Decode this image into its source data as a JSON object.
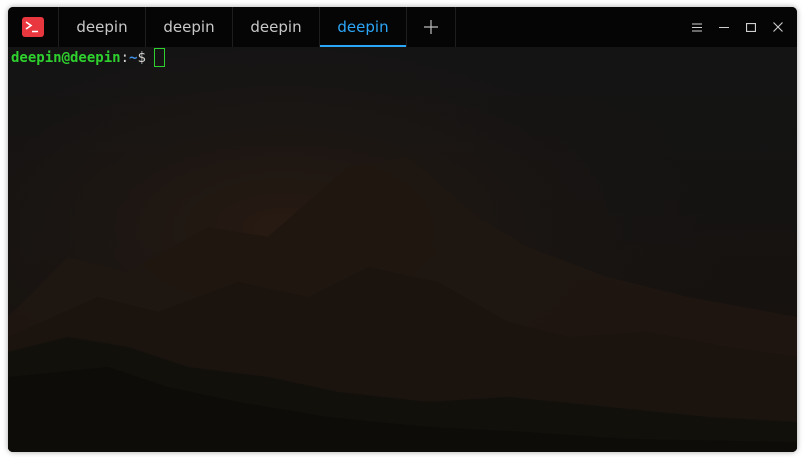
{
  "app": {
    "icon": "terminal-icon",
    "accent_color": "#e8373e"
  },
  "tabs": [
    {
      "label": "deepin",
      "active": false
    },
    {
      "label": "deepin",
      "active": false
    },
    {
      "label": "deepin",
      "active": false
    },
    {
      "label": "deepin",
      "active": true
    }
  ],
  "tab_active_color": "#2ca7f8",
  "new_tab": {
    "icon": "plus-icon"
  },
  "window_controls": [
    {
      "name": "menu",
      "icon": "hamburger-menu-icon"
    },
    {
      "name": "minimize",
      "icon": "minimize-icon"
    },
    {
      "name": "maximize",
      "icon": "maximize-icon"
    },
    {
      "name": "close",
      "icon": "close-icon"
    }
  ],
  "terminal": {
    "prompt_user": "deepin@deepin",
    "prompt_sep": ":",
    "prompt_path": "~",
    "prompt_symbol": "$",
    "prompt_color": "#2ed12e",
    "path_color": "#3f8fe6"
  }
}
